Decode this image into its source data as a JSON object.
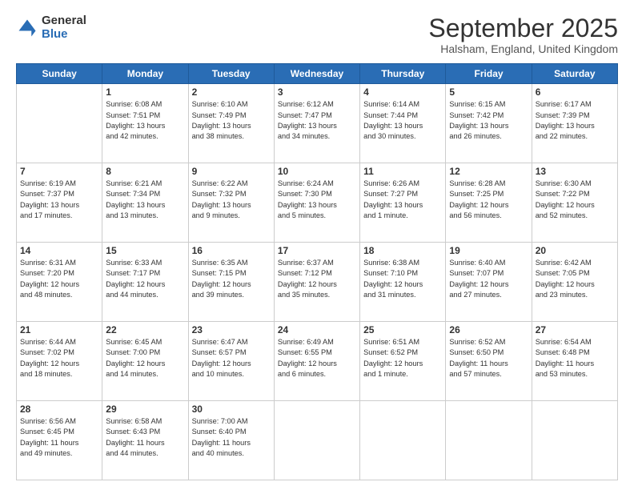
{
  "header": {
    "logo_general": "General",
    "logo_blue": "Blue",
    "month_title": "September 2025",
    "location": "Halsham, England, United Kingdom"
  },
  "days_of_week": [
    "Sunday",
    "Monday",
    "Tuesday",
    "Wednesday",
    "Thursday",
    "Friday",
    "Saturday"
  ],
  "weeks": [
    [
      {
        "day": "",
        "content": ""
      },
      {
        "day": "1",
        "content": "Sunrise: 6:08 AM\nSunset: 7:51 PM\nDaylight: 13 hours\nand 42 minutes."
      },
      {
        "day": "2",
        "content": "Sunrise: 6:10 AM\nSunset: 7:49 PM\nDaylight: 13 hours\nand 38 minutes."
      },
      {
        "day": "3",
        "content": "Sunrise: 6:12 AM\nSunset: 7:47 PM\nDaylight: 13 hours\nand 34 minutes."
      },
      {
        "day": "4",
        "content": "Sunrise: 6:14 AM\nSunset: 7:44 PM\nDaylight: 13 hours\nand 30 minutes."
      },
      {
        "day": "5",
        "content": "Sunrise: 6:15 AM\nSunset: 7:42 PM\nDaylight: 13 hours\nand 26 minutes."
      },
      {
        "day": "6",
        "content": "Sunrise: 6:17 AM\nSunset: 7:39 PM\nDaylight: 13 hours\nand 22 minutes."
      }
    ],
    [
      {
        "day": "7",
        "content": "Sunrise: 6:19 AM\nSunset: 7:37 PM\nDaylight: 13 hours\nand 17 minutes."
      },
      {
        "day": "8",
        "content": "Sunrise: 6:21 AM\nSunset: 7:34 PM\nDaylight: 13 hours\nand 13 minutes."
      },
      {
        "day": "9",
        "content": "Sunrise: 6:22 AM\nSunset: 7:32 PM\nDaylight: 13 hours\nand 9 minutes."
      },
      {
        "day": "10",
        "content": "Sunrise: 6:24 AM\nSunset: 7:30 PM\nDaylight: 13 hours\nand 5 minutes."
      },
      {
        "day": "11",
        "content": "Sunrise: 6:26 AM\nSunset: 7:27 PM\nDaylight: 13 hours\nand 1 minute."
      },
      {
        "day": "12",
        "content": "Sunrise: 6:28 AM\nSunset: 7:25 PM\nDaylight: 12 hours\nand 56 minutes."
      },
      {
        "day": "13",
        "content": "Sunrise: 6:30 AM\nSunset: 7:22 PM\nDaylight: 12 hours\nand 52 minutes."
      }
    ],
    [
      {
        "day": "14",
        "content": "Sunrise: 6:31 AM\nSunset: 7:20 PM\nDaylight: 12 hours\nand 48 minutes."
      },
      {
        "day": "15",
        "content": "Sunrise: 6:33 AM\nSunset: 7:17 PM\nDaylight: 12 hours\nand 44 minutes."
      },
      {
        "day": "16",
        "content": "Sunrise: 6:35 AM\nSunset: 7:15 PM\nDaylight: 12 hours\nand 39 minutes."
      },
      {
        "day": "17",
        "content": "Sunrise: 6:37 AM\nSunset: 7:12 PM\nDaylight: 12 hours\nand 35 minutes."
      },
      {
        "day": "18",
        "content": "Sunrise: 6:38 AM\nSunset: 7:10 PM\nDaylight: 12 hours\nand 31 minutes."
      },
      {
        "day": "19",
        "content": "Sunrise: 6:40 AM\nSunset: 7:07 PM\nDaylight: 12 hours\nand 27 minutes."
      },
      {
        "day": "20",
        "content": "Sunrise: 6:42 AM\nSunset: 7:05 PM\nDaylight: 12 hours\nand 23 minutes."
      }
    ],
    [
      {
        "day": "21",
        "content": "Sunrise: 6:44 AM\nSunset: 7:02 PM\nDaylight: 12 hours\nand 18 minutes."
      },
      {
        "day": "22",
        "content": "Sunrise: 6:45 AM\nSunset: 7:00 PM\nDaylight: 12 hours\nand 14 minutes."
      },
      {
        "day": "23",
        "content": "Sunrise: 6:47 AM\nSunset: 6:57 PM\nDaylight: 12 hours\nand 10 minutes."
      },
      {
        "day": "24",
        "content": "Sunrise: 6:49 AM\nSunset: 6:55 PM\nDaylight: 12 hours\nand 6 minutes."
      },
      {
        "day": "25",
        "content": "Sunrise: 6:51 AM\nSunset: 6:52 PM\nDaylight: 12 hours\nand 1 minute."
      },
      {
        "day": "26",
        "content": "Sunrise: 6:52 AM\nSunset: 6:50 PM\nDaylight: 11 hours\nand 57 minutes."
      },
      {
        "day": "27",
        "content": "Sunrise: 6:54 AM\nSunset: 6:48 PM\nDaylight: 11 hours\nand 53 minutes."
      }
    ],
    [
      {
        "day": "28",
        "content": "Sunrise: 6:56 AM\nSunset: 6:45 PM\nDaylight: 11 hours\nand 49 minutes."
      },
      {
        "day": "29",
        "content": "Sunrise: 6:58 AM\nSunset: 6:43 PM\nDaylight: 11 hours\nand 44 minutes."
      },
      {
        "day": "30",
        "content": "Sunrise: 7:00 AM\nSunset: 6:40 PM\nDaylight: 11 hours\nand 40 minutes."
      },
      {
        "day": "",
        "content": ""
      },
      {
        "day": "",
        "content": ""
      },
      {
        "day": "",
        "content": ""
      },
      {
        "day": "",
        "content": ""
      }
    ]
  ]
}
